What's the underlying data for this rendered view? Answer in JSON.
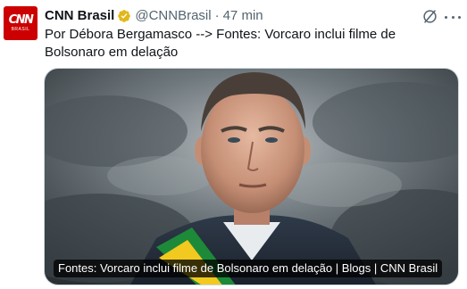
{
  "author": {
    "display_name": "CNN Brasil",
    "handle": "@CNNBrasil",
    "separator": "·",
    "time": "47 min",
    "avatar": {
      "logo_text": "CNN",
      "logo_subtext": "BRASIL",
      "color": "#cc0000"
    },
    "verified_badge_color": "#e2b719"
  },
  "actions": {
    "grok_icon": "grok-icon",
    "more_icon": "more-icon"
  },
  "tweet": {
    "text": "Por Débora Bergamasco --> Fontes: Vorcaro inclui filme de Bolsonaro em delação"
  },
  "media": {
    "caption": "Fontes: Vorcaro inclui filme de Bolsonaro em delação | Blogs | CNN Brasil"
  }
}
